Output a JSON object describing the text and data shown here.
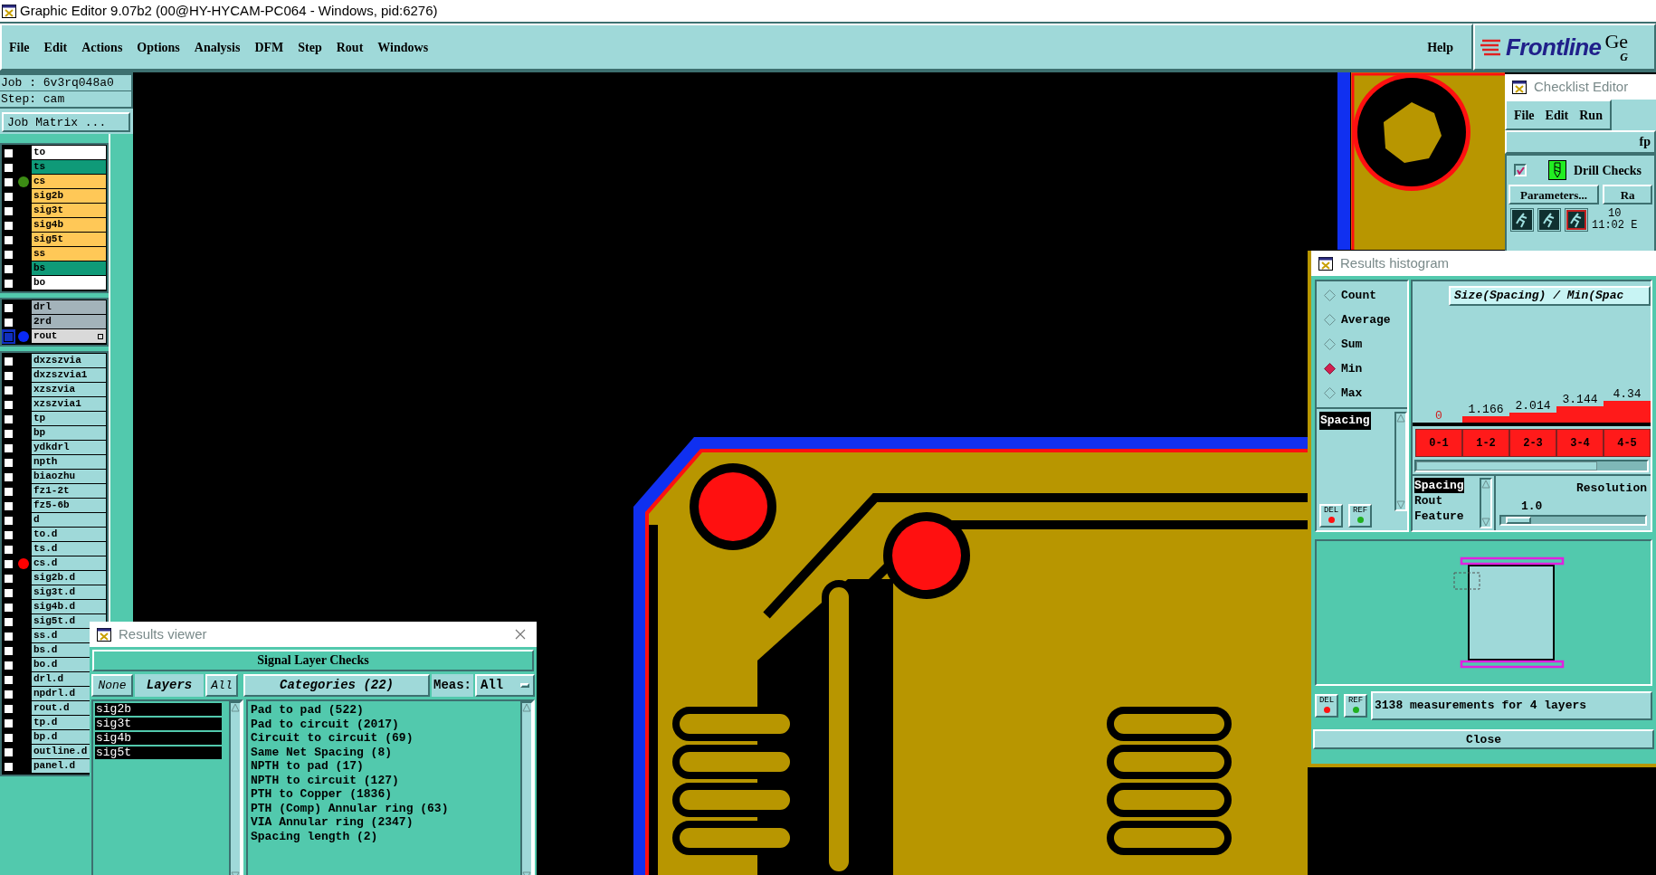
{
  "window": {
    "title": "Graphic Editor 9.07b2 (00@HY-HYCAM-PC064 - Windows, pid:6276)"
  },
  "menu": [
    "File",
    "Edit",
    "Actions",
    "Options",
    "Analysis",
    "DFM",
    "Step",
    "Rout",
    "Windows"
  ],
  "help": "Help",
  "brand": {
    "logo": "Frontline",
    "product": "Ge",
    "subtitle": "G"
  },
  "job": {
    "job": "Job : 6v3rq048a0",
    "step": "Step: cam",
    "matrix_button": "Job Matrix ..."
  },
  "layer_groups": [
    [
      {
        "name": "to",
        "kind": "silk",
        "checked": false,
        "work": false
      },
      {
        "name": "ts",
        "kind": "mask",
        "checked": false,
        "work": false
      },
      {
        "name": "cs",
        "kind": "signal",
        "color": "#3c8c14",
        "checked": false,
        "work": false
      },
      {
        "name": "sig2b",
        "kind": "signal",
        "checked": false,
        "work": false
      },
      {
        "name": "sig3t",
        "kind": "signal",
        "checked": false,
        "work": false
      },
      {
        "name": "sig4b",
        "kind": "signal",
        "checked": false,
        "work": false
      },
      {
        "name": "sig5t",
        "kind": "signal",
        "checked": false,
        "work": false
      },
      {
        "name": "ss",
        "kind": "signal",
        "checked": false,
        "work": false
      },
      {
        "name": "bs",
        "kind": "mask",
        "checked": false,
        "work": false
      },
      {
        "name": "bo",
        "kind": "silk",
        "checked": false,
        "work": false
      }
    ],
    [
      {
        "name": "drl",
        "kind": "drill",
        "checked": false,
        "work": false
      },
      {
        "name": "2rd",
        "kind": "drill",
        "checked": false,
        "work": false
      },
      {
        "name": "rout",
        "kind": "rout",
        "color": "#0a2af5",
        "checked": false,
        "work": true
      }
    ],
    [
      {
        "name": "dxzszvia",
        "kind": "misc",
        "checked": false,
        "work": false
      },
      {
        "name": "dxzszvia1",
        "kind": "misc",
        "checked": false,
        "work": false
      },
      {
        "name": "xzszvia",
        "kind": "misc",
        "checked": false,
        "work": false
      },
      {
        "name": "xzszvia1",
        "kind": "misc",
        "checked": false,
        "work": false
      },
      {
        "name": "tp",
        "kind": "misc",
        "checked": false,
        "work": false
      },
      {
        "name": "bp",
        "kind": "misc",
        "checked": false,
        "work": false
      },
      {
        "name": "ydkdrl",
        "kind": "misc",
        "checked": false,
        "work": false
      },
      {
        "name": "npth",
        "kind": "misc",
        "checked": false,
        "work": false
      },
      {
        "name": "biaozhu",
        "kind": "misc",
        "checked": false,
        "work": false
      },
      {
        "name": "fz1-2t",
        "kind": "misc",
        "checked": false,
        "work": false
      },
      {
        "name": "fz5-6b",
        "kind": "misc",
        "checked": false,
        "work": false
      },
      {
        "name": "d",
        "kind": "misc",
        "checked": false,
        "work": false
      },
      {
        "name": "to.d",
        "kind": "misc",
        "checked": false,
        "work": false
      },
      {
        "name": "ts.d",
        "kind": "misc",
        "checked": false,
        "work": false
      },
      {
        "name": "cs.d",
        "kind": "misc",
        "color": "#ff0000",
        "checked": false,
        "work": false
      },
      {
        "name": "sig2b.d",
        "kind": "misc",
        "checked": false,
        "work": false
      },
      {
        "name": "sig3t.d",
        "kind": "misc",
        "checked": false,
        "work": false
      },
      {
        "name": "sig4b.d",
        "kind": "misc",
        "checked": false,
        "work": false
      },
      {
        "name": "sig5t.d",
        "kind": "misc",
        "checked": false,
        "work": false
      },
      {
        "name": "ss.d",
        "kind": "misc",
        "checked": false,
        "work": false
      },
      {
        "name": "bs.d",
        "kind": "misc",
        "checked": false,
        "work": false
      },
      {
        "name": "bo.d",
        "kind": "misc",
        "checked": false,
        "work": false
      },
      {
        "name": "drl.d",
        "kind": "misc",
        "checked": false,
        "work": false
      },
      {
        "name": "npdrl.d",
        "kind": "misc",
        "checked": false,
        "work": false
      },
      {
        "name": "rout.d",
        "kind": "misc",
        "checked": false,
        "work": false
      },
      {
        "name": "tp.d",
        "kind": "misc",
        "checked": false,
        "work": false
      },
      {
        "name": "bp.d",
        "kind": "misc",
        "checked": false,
        "work": false
      },
      {
        "name": "outline.d",
        "kind": "misc",
        "checked": false,
        "work": false
      },
      {
        "name": "panel.d",
        "kind": "misc",
        "checked": false,
        "work": false
      }
    ]
  ],
  "checklist": {
    "title": "Checklist Editor",
    "menu": [
      "File",
      "Edit",
      "Run"
    ],
    "name": "fp",
    "check": {
      "label": "Drill Checks",
      "checked": true
    },
    "parameters_button": "Parameters...",
    "second_button": "Ra",
    "date": "10",
    "time": "11:02 E"
  },
  "histogram": {
    "title": "Results histogram",
    "modes": [
      {
        "label": "Count",
        "selected": false
      },
      {
        "label": "Average",
        "selected": false
      },
      {
        "label": "Sum",
        "selected": false
      },
      {
        "label": "Min",
        "selected": true
      },
      {
        "label": "Max",
        "selected": false
      }
    ],
    "measures": [
      {
        "label": "Spacing",
        "selected": true
      }
    ],
    "measure_buttons": [
      "DEL",
      "REF"
    ],
    "chart_title": "Size(Spacing) / Min(Spac",
    "chart_data": {
      "type": "bar",
      "categories": [
        "0-1",
        "1-2",
        "2-3",
        "3-4",
        "4-5"
      ],
      "values": [
        0,
        1.166,
        2.014,
        3.144,
        4.34
      ],
      "data_labels": true
    },
    "sources": [
      {
        "label": "Spacing",
        "selected": true
      },
      {
        "label": "Rout",
        "selected": false
      },
      {
        "label": "Feature",
        "selected": false
      }
    ],
    "resolution_label": "Resolution",
    "resolution_value": "1.0",
    "resolution": {
      "level": 0.12
    },
    "summary_buttons": [
      "DEL",
      "REF"
    ],
    "summary": "3138 measurements for 4 layers",
    "close": "Close"
  },
  "viewer": {
    "title": "Results viewer",
    "header": "Signal Layer Checks",
    "none_button": "None",
    "layers_label": "Layers",
    "all_button": "All",
    "categories_button": "Categories (22)",
    "meas_label": "Meas:",
    "meas_value": "All",
    "layers": [
      {
        "name": "sig2b",
        "selected": true
      },
      {
        "name": "sig3t",
        "selected": true
      },
      {
        "name": "sig4b",
        "selected": true
      },
      {
        "name": "sig5t",
        "selected": true
      }
    ],
    "categories": [
      {
        "label": "Pad to pad (522)",
        "selected": false
      },
      {
        "label": "Pad to circuit (2017)",
        "selected": false
      },
      {
        "label": "Circuit to circuit (69)",
        "selected": false
      },
      {
        "label": "Same Net Spacing (8)",
        "selected": false
      },
      {
        "label": "NPTH to pad (17)",
        "selected": false
      },
      {
        "label": "NPTH to circuit (127)",
        "selected": false
      },
      {
        "label": "PTH to Copper (1836)",
        "selected": false
      },
      {
        "label": "PTH (Comp) Annular ring (63)",
        "selected": false
      },
      {
        "label": "VIA Annular ring (2347)",
        "selected": false
      },
      {
        "label": "Spacing length (2)",
        "selected": false
      }
    ]
  }
}
